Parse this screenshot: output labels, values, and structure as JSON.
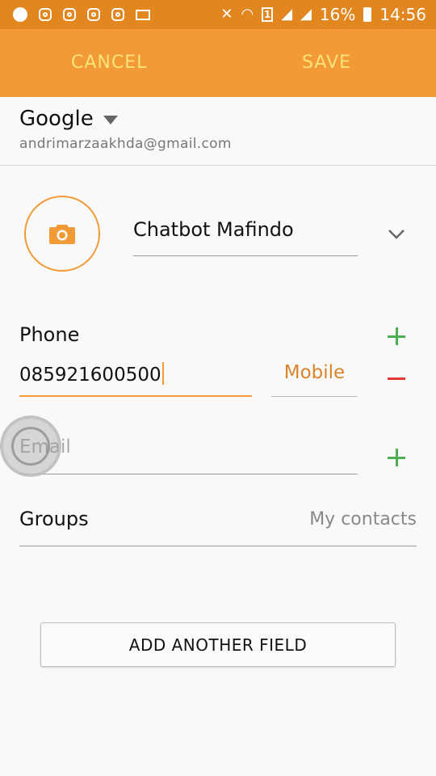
{
  "status_bar": {
    "battery_percent": "16%",
    "time": "14:56",
    "sim_slot": "1",
    "icons": [
      "notification-dot-icon",
      "instagram-icon",
      "instagram-icon",
      "instagram-icon",
      "instagram-icon",
      "mail-icon",
      "vibrate-mute-icon",
      "wifi-icon",
      "sim-icon",
      "signal-icon",
      "signal-icon",
      "battery-icon"
    ]
  },
  "appbar": {
    "cancel_label": "CANCEL",
    "save_label": "SAVE"
  },
  "account": {
    "name": "Google",
    "email": "andrimarzaakhda@gmail.com"
  },
  "contact": {
    "name_value": "Chatbot Mafindo"
  },
  "phone": {
    "label": "Phone",
    "value": "085921600500",
    "type": "Mobile"
  },
  "email_field": {
    "placeholder": "Email"
  },
  "groups": {
    "label": "Groups",
    "value": "My contacts"
  },
  "add_field_label": "ADD ANOTHER FIELD",
  "colors": {
    "accent": "#f29a36",
    "status_bar": "#e2861f",
    "add": "#4caf50",
    "remove": "#e53935",
    "action_text": "#fde37a"
  }
}
